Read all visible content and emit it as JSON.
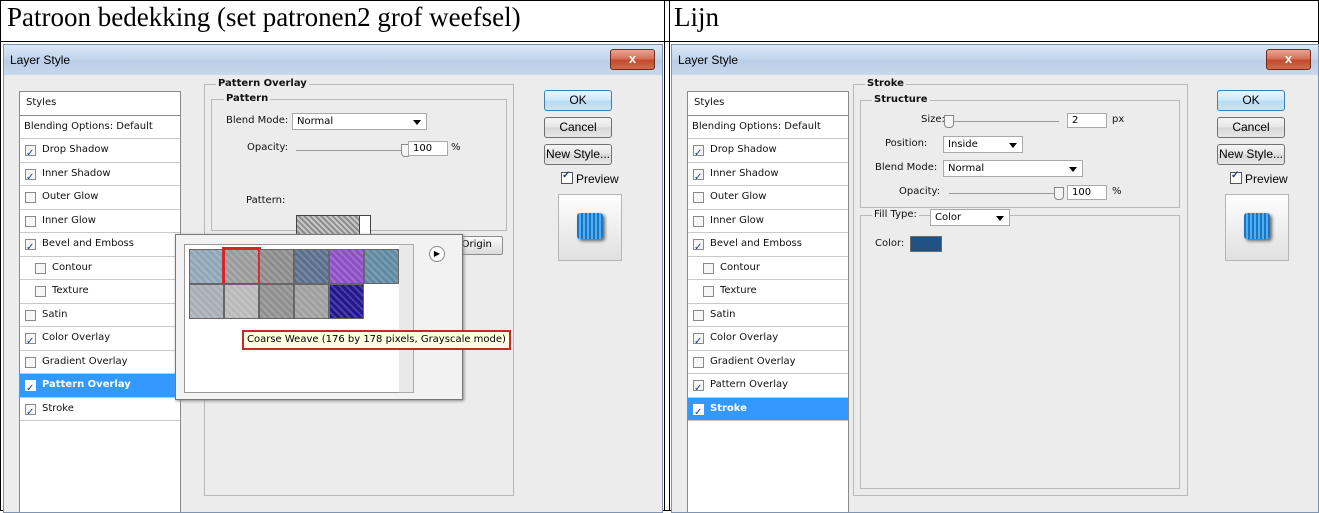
{
  "headers": {
    "left": "Patroon bedekking (set patronen2  grof weefsel)",
    "right": "Lijn"
  },
  "dialog_title": "Layer Style",
  "close_glyph": "x",
  "buttons": {
    "ok": "OK",
    "cancel": "Cancel",
    "new_style": "New Style...",
    "preview": "Preview"
  },
  "styles_list": {
    "header": "Styles",
    "items": [
      "Blending Options: Default",
      "Drop Shadow",
      "Inner Shadow",
      "Outer Glow",
      "Inner Glow",
      "Bevel and Emboss",
      "Contour",
      "Texture",
      "Satin",
      "Color Overlay",
      "Gradient Overlay",
      "Pattern Overlay",
      "Stroke"
    ]
  },
  "left_dialog": {
    "checked": [
      false,
      true,
      true,
      false,
      false,
      true,
      false,
      false,
      false,
      true,
      false,
      true,
      true
    ],
    "selected_index": 11,
    "section_title": "Pattern Overlay",
    "group_title": "Pattern",
    "blend_mode_label": "Blend Mode:",
    "blend_mode_value": "Normal",
    "opacity_label": "Opacity:",
    "opacity_value": "100",
    "opacity_unit": "%",
    "opacity_level": 1.0,
    "pattern_label": "Pattern:",
    "snap_button": "Snap to Origin",
    "tooltip": "Coarse Weave (176 by 178 pixels, Grayscale mode)",
    "swatch_colors": [
      [
        "#8fa6b8",
        "#9a9a9a",
        "#8c8c8c",
        "#5b6f8f",
        "#8b4fc6",
        "#5f8aa3"
      ],
      [
        "#a7aeb5",
        "#b9b9b9",
        "#8f8f8f",
        "#a0a0a0",
        "#23178f"
      ]
    ],
    "selected_swatch": [
      0,
      1
    ]
  },
  "right_dialog": {
    "checked": [
      false,
      true,
      true,
      false,
      false,
      true,
      false,
      false,
      false,
      true,
      false,
      true,
      true
    ],
    "selected_index": 12,
    "section_title": "Stroke",
    "group_title": "Structure",
    "size_label": "Size:",
    "size_value": "2",
    "size_unit": "px",
    "size_level": 0.0,
    "position_label": "Position:",
    "position_value": "Inside",
    "blend_mode_label": "Blend Mode:",
    "blend_mode_value": "Normal",
    "opacity_label": "Opacity:",
    "opacity_value": "100",
    "opacity_unit": "%",
    "opacity_level": 1.0,
    "fill_type_label": "Fill Type:",
    "fill_type_value": "Color",
    "color_label": "Color:",
    "stroke_color": "#1f5182"
  },
  "colors": {
    "selection": "#3399ff",
    "highlight_red": "#d7242a"
  }
}
